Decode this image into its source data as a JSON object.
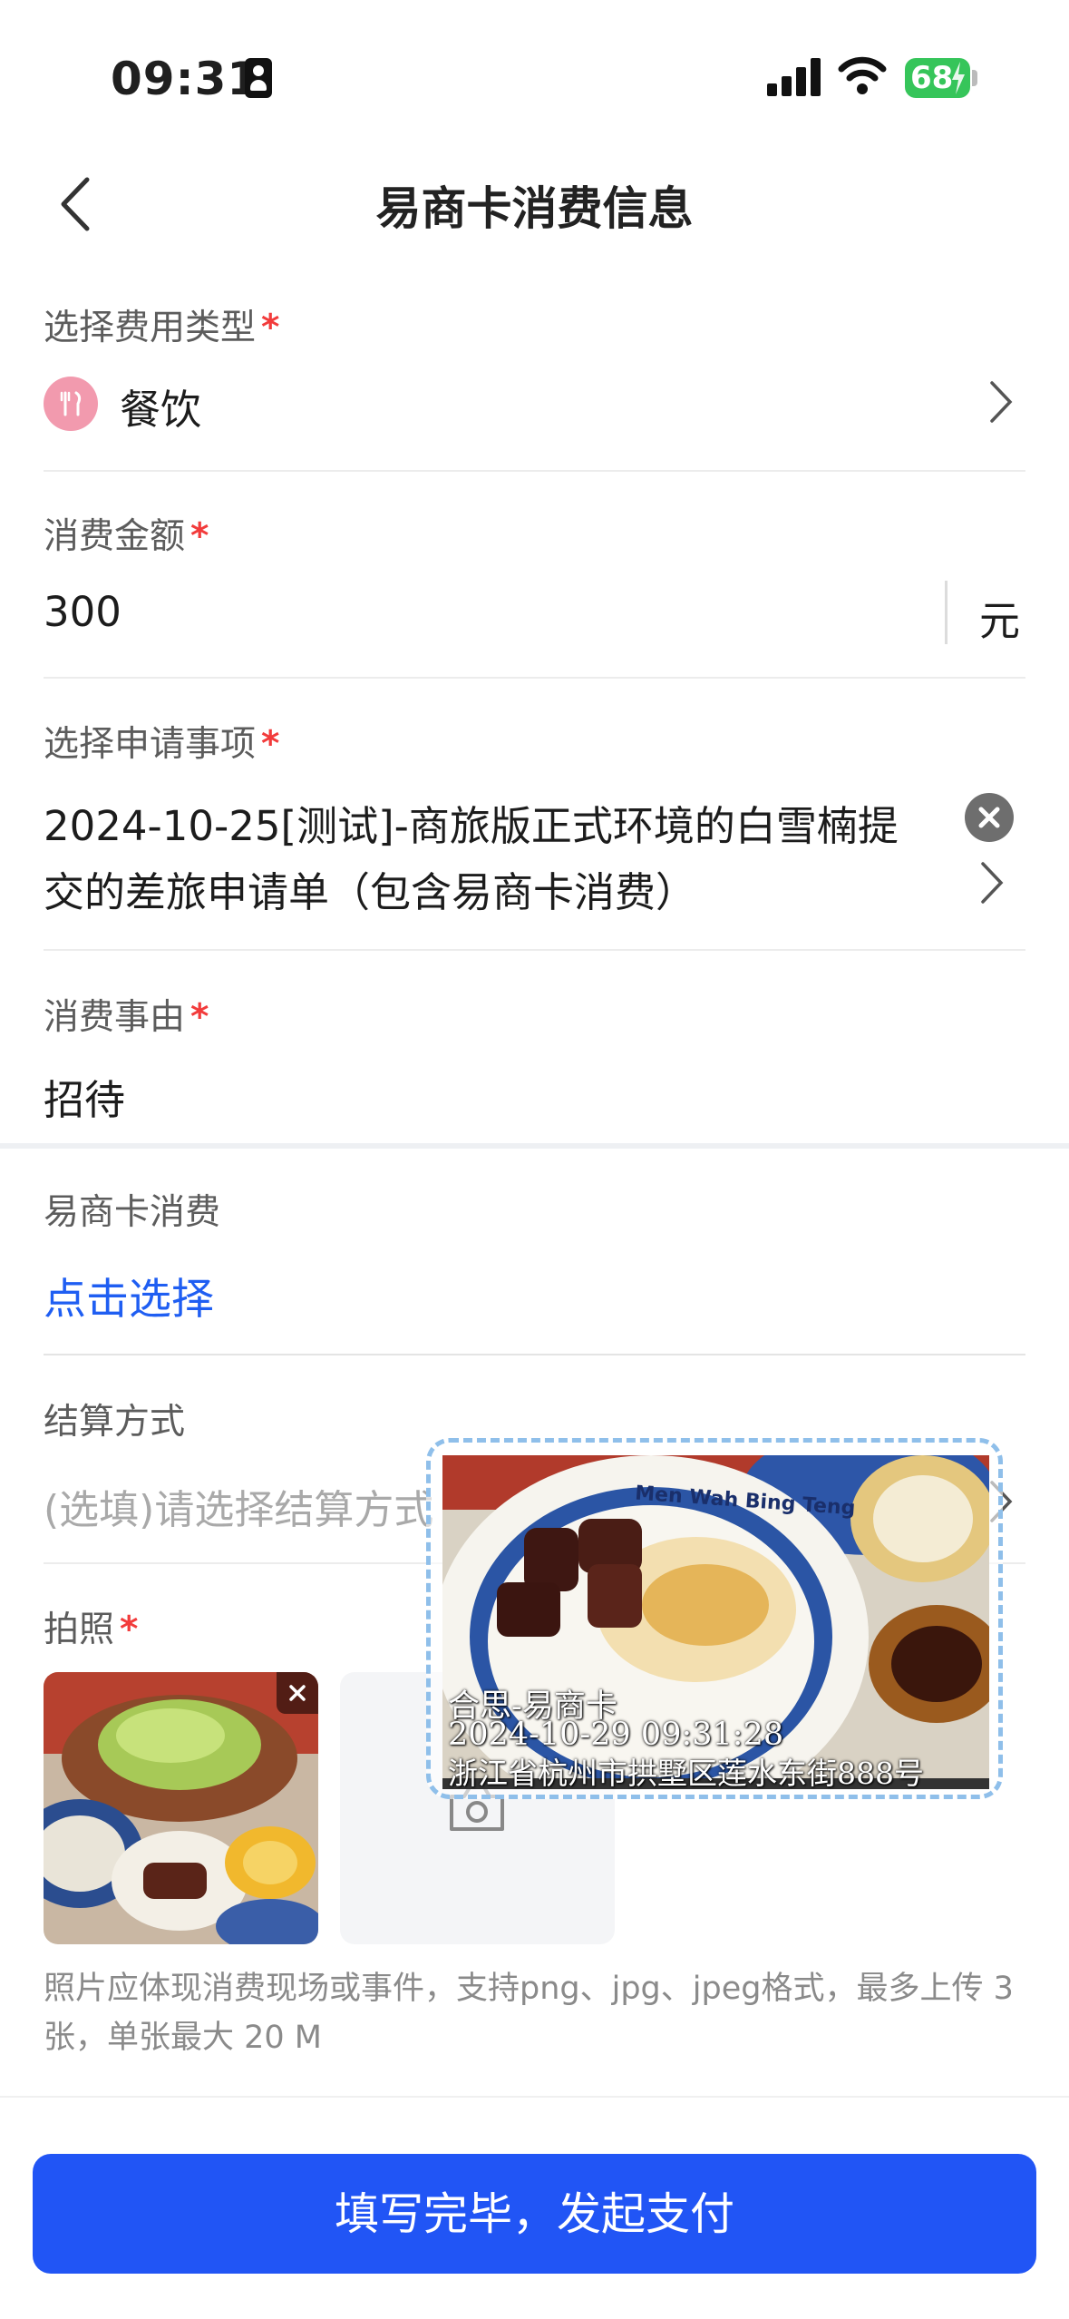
{
  "status_bar": {
    "time": "09:31",
    "battery": "68"
  },
  "nav": {
    "title": "易商卡消费信息"
  },
  "expense_type": {
    "label": "选择费用类型",
    "required": "*",
    "value": "餐饮"
  },
  "amount": {
    "label": "消费金额",
    "required": "*",
    "value": "300",
    "unit": "元"
  },
  "application": {
    "label": "选择申请事项",
    "required": "*",
    "value_line1": "2024-10-25[测试]-商旅版正式环境的白雪楠提",
    "value_line2": "交的差旅申请单（包含易商卡消费）"
  },
  "reason": {
    "label": "消费事由",
    "required": "*",
    "value": "招待"
  },
  "card": {
    "label": "易商卡消费",
    "link": "点击选择"
  },
  "settlement": {
    "label": "结算方式",
    "placeholder": "(选填)请选择结算方式"
  },
  "photo": {
    "label": "拍照",
    "required": "*",
    "hint": "照片应体现消费现场或事件，支持png、jpg、jpeg格式，最多上传 3 张，单张最大 20 M"
  },
  "preview": {
    "plate_text": "Men Wah Bing Teng",
    "watermark_line1": "合思-易商卡",
    "watermark_line2": "2024-10-29 09:31:28",
    "watermark_line3": "浙江省杭州市拱墅区莲水东街888号"
  },
  "submit": {
    "label": "填写完毕，发起支付"
  },
  "colors": {
    "accent": "#2155f5",
    "required": "#f23b3b",
    "link": "#1f5ef2"
  }
}
